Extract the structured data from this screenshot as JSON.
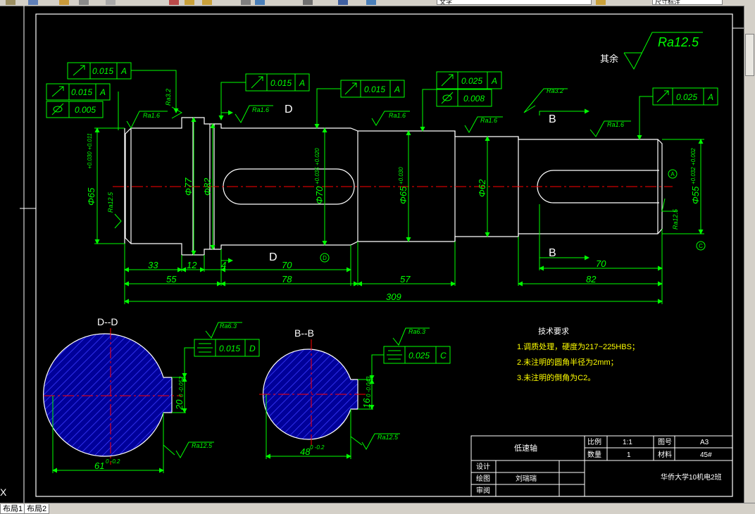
{
  "toolbar": {
    "layer_combo": "文字",
    "style_combo": "尺寸标注"
  },
  "drawing": {
    "note_label": "其余",
    "roughness_global": "Ra12.5",
    "tolerances": {
      "t1": "0.015",
      "t1_datum": "A",
      "t2": "0.015",
      "t2_datum": "A",
      "t3": "0.005",
      "t4": "0.015",
      "t4_datum": "A",
      "t5": "0.015",
      "t5_datum": "A",
      "t6": "0.025",
      "t6_datum": "A",
      "t7": "0.008",
      "t8": "0.025",
      "t8_datum": "A",
      "t9": "0.015",
      "t9_datum": "D",
      "t10": "0.025",
      "t10_datum": "C"
    },
    "roughness": {
      "r1": "Ra3.2",
      "r2": "Ra1.6",
      "r3": "Ra1.6",
      "r4": "Ra1.6",
      "r5": "Ra1.6",
      "r6": "Ra3.2",
      "r7": "Ra1.6",
      "r8": "Ra12.5",
      "r9": "Ra12.5",
      "r10": "Ra6.3",
      "r11": "Ra6.3",
      "r12": "Ra12.5",
      "r13": "Ra12.5"
    },
    "section_labels": {
      "d_top": "D",
      "d_bottom": "D",
      "b_top": "B",
      "b_bottom": "B",
      "section_dd": "D--D",
      "section_bb": "B--B"
    },
    "datum_markers": {
      "a": "A",
      "c": "C",
      "d": "D"
    },
    "diameters": {
      "d1": "Φ65",
      "d1_tol": "+0.030 +0.011",
      "d2": "Φ77",
      "d3": "Φ82",
      "d4": "Φ70",
      "d4_tol": "+0.035 +0.020",
      "d5": "Φ65",
      "d5_tol": "+0.030",
      "d6": "Φ62",
      "d7": "Φ55",
      "d7_tol": "+0.032 +0.002"
    },
    "lengths": {
      "l33": "33",
      "l12": "12",
      "l4": "4",
      "l70a": "70",
      "l55": "55",
      "l78": "78",
      "l57": "57",
      "l70b": "70",
      "l82": "82",
      "l309": "309"
    },
    "section_dims": {
      "dd_depth": "20",
      "dd_depth_tol": "0 -0.052",
      "dd_width": "61",
      "dd_width_tol": "0 -0.2",
      "bb_depth": "16",
      "bb_depth_tol": "0 -0.043",
      "bb_width": "48",
      "bb_width_tol": "0 -0.2"
    },
    "tech_requirements": {
      "title": "技术要求",
      "item1": "1.调质处理，硬度为217~225HBS；",
      "item2": "2.未注明的圆角半径为2mm；",
      "item3": "3.未注明的倒角为C2。"
    },
    "title_block": {
      "part_name": "低速轴",
      "scale_label": "比例",
      "scale_value": "1:1",
      "drawing_no_label": "图号",
      "drawing_no_value": "A3",
      "qty_label": "数量",
      "qty_value": "1",
      "material_label": "材料",
      "material_value": "45#",
      "design_label": "设计",
      "draw_label": "绘图",
      "drawer_name": "刘瑞瑞",
      "review_label": "审阅",
      "school": "华侨大学10机电2班"
    }
  },
  "colors": {
    "background": "#000000",
    "frame": "#ffffff",
    "geometry": "#ffffff",
    "dimension": "#00ff00",
    "centerline": "#ff0000",
    "hatch": "#0000cc"
  },
  "layout_tabs": [
    "布局1",
    "布局2"
  ]
}
